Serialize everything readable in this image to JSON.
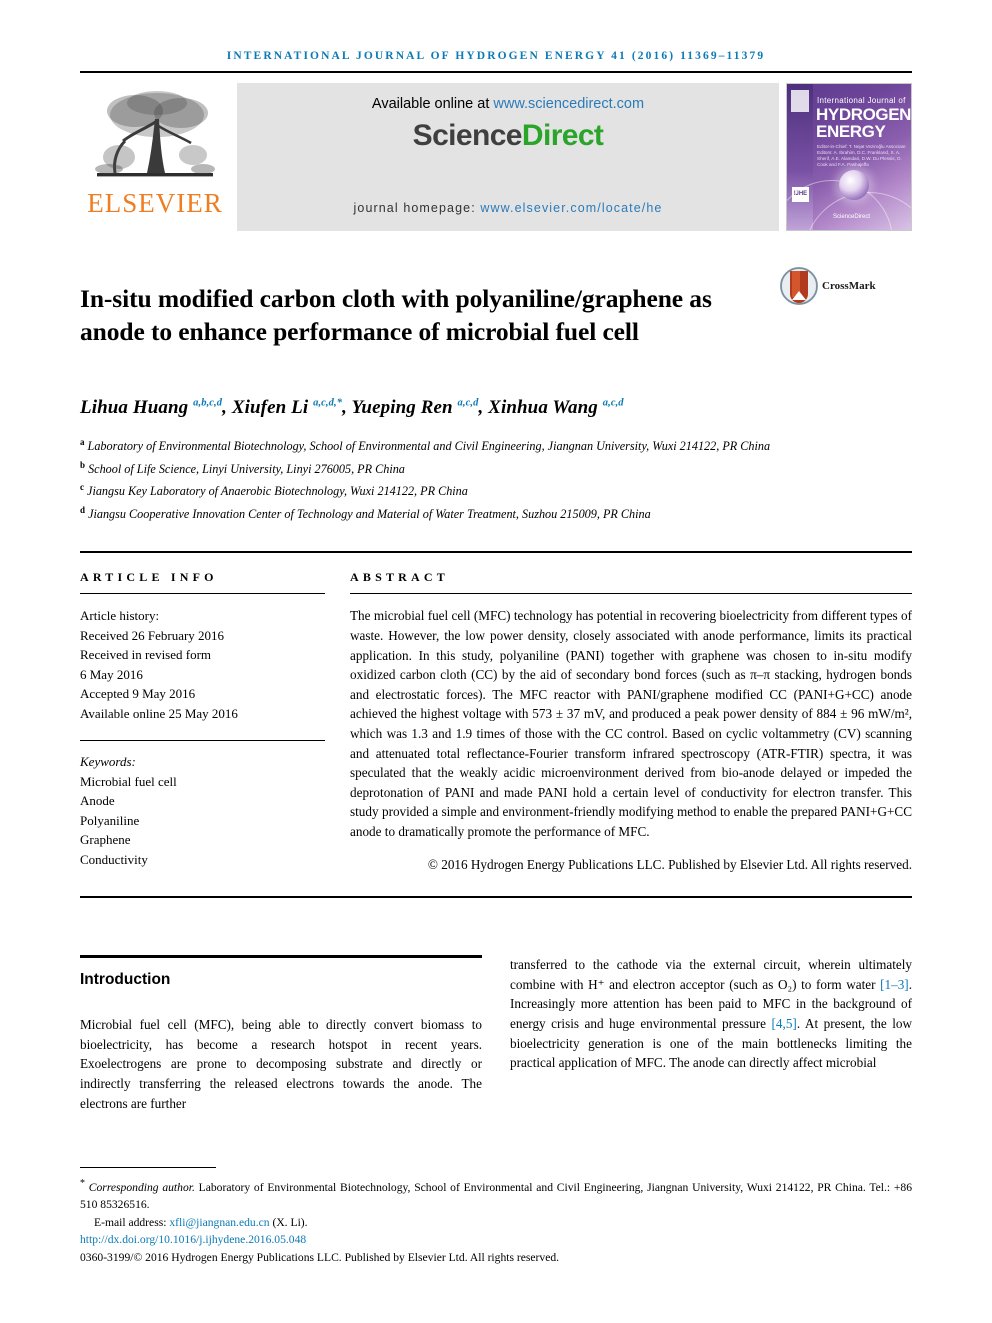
{
  "running_head": "International Journal of Hydrogen Energy 41 (2016) 11369–11379",
  "masthead": {
    "elsevier_wordmark": "ELSEVIER",
    "available_online_label": "Available online at",
    "available_online_url": "www.sciencedirect.com",
    "sciencedirect_part1": "Science",
    "sciencedirect_part2": "Direct",
    "journal_homepage_label": "journal homepage:",
    "journal_homepage_url": "www.elsevier.com/locate/he",
    "cover": {
      "small_title": "International Journal of",
      "big_title_line1": "HYDROGEN",
      "big_title_line2": "ENERGY",
      "editors": "Editor-in-Chief: T. Nejat Veziroğlu   Associate Editors: A. Ibrahim, D.C. Frankland, S. A. Sherif, A.E. Alamdari, D.W. Du Plessis, D. Cook and F.A. Pashajeffa",
      "ijhe_badge": "IJHE",
      "sciencedirect_mark": "ScienceDirect"
    }
  },
  "crossmark": {
    "label": "CrossMark"
  },
  "article": {
    "title": "In-situ modified carbon cloth with polyaniline/graphene as anode to enhance performance of microbial fuel cell",
    "authors": [
      {
        "name": "Lihua Huang",
        "sup": "a,b,c,d",
        "sep": ", "
      },
      {
        "name": "Xiufen Li",
        "sup": "a,c,d,*",
        "sep": ", "
      },
      {
        "name": "Yueping Ren",
        "sup": "a,c,d",
        "sep": ", "
      },
      {
        "name": "Xinhua Wang",
        "sup": "a,c,d",
        "sep": ""
      }
    ],
    "affiliations": [
      {
        "mark": "a",
        "text": "Laboratory of Environmental Biotechnology, School of Environmental and Civil Engineering, Jiangnan University, Wuxi 214122, PR China"
      },
      {
        "mark": "b",
        "text": "School of Life Science, Linyi University, Linyi 276005, PR China"
      },
      {
        "mark": "c",
        "text": "Jiangsu Key Laboratory of Anaerobic Biotechnology, Wuxi 214122, PR China"
      },
      {
        "mark": "d",
        "text": "Jiangsu Cooperative Innovation Center of Technology and Material of Water Treatment, Suzhou 215009, PR China"
      }
    ]
  },
  "article_info": {
    "heading": "Article info",
    "history_title": "Article history:",
    "history": [
      "Received 26 February 2016",
      "Received in revised form",
      "6 May 2016",
      "Accepted 9 May 2016",
      "Available online 25 May 2016"
    ],
    "keywords_title": "Keywords:",
    "keywords": [
      "Microbial fuel cell",
      "Anode",
      "Polyaniline",
      "Graphene",
      "Conductivity"
    ]
  },
  "abstract": {
    "heading": "Abstract",
    "text": "The microbial fuel cell (MFC) technology has potential in recovering bioelectricity from different types of waste. However, the low power density, closely associated with anode performance, limits its practical application. In this study, polyaniline (PANI) together with graphene was chosen to in-situ modify oxidized carbon cloth (CC) by the aid of secondary bond forces (such as π–π stacking, hydrogen bonds and electrostatic forces). The MFC reactor with PANI/graphene modified CC (PANI+G+CC) anode achieved the highest voltage with 573 ± 37 mV, and produced a peak power density of 884 ± 96 mW/m², which was 1.3 and 1.9 times of those with the CC control. Based on cyclic voltammetry (CV) scanning and attenuated total reflectance-Fourier transform infrared spectroscopy (ATR-FTIR) spectra, it was speculated that the weakly acidic microenvironment derived from bio-anode delayed or impeded the deprotonation of PANI and made PANI hold a certain level of conductivity for electron transfer. This study provided a simple and environment-friendly modifying method to enable the prepared PANI+G+CC anode to dramatically promote the performance of MFC.",
    "copyright": "© 2016 Hydrogen Energy Publications LLC. Published by Elsevier Ltd. All rights reserved."
  },
  "introduction": {
    "heading": "Introduction",
    "left_paragraph": "Microbial fuel cell (MFC), being able to directly convert biomass to bioelectricity, has become a research hotspot in recent years. Exoelectrogens are prone to decomposing substrate and directly or indirectly transferring the released electrons towards the anode. The electrons are further",
    "right_paragraph_part1": "transferred to the cathode via the external circuit, wherein ultimately combine with H⁺ and electron acceptor (such as O₂) to form water ",
    "right_citation1": "[1–3]",
    "right_paragraph_part2": ". Increasingly more attention has been paid to MFC in the background of energy crisis and huge environmental pressure ",
    "right_citation2": "[4,5]",
    "right_paragraph_part3": ". At present, the low bioelectricity generation is one of the main bottlenecks limiting the practical application of MFC. The anode can directly affect microbial"
  },
  "footer": {
    "corresponding_label": "Corresponding author.",
    "corresponding_text": " Laboratory of Environmental Biotechnology, School of Environmental and Civil Engineering, Jiangnan University, Wuxi 214122, PR China. Tel.: +86 510 85326516.",
    "email_label": "E-mail address:",
    "email": "xfli@jiangnan.edu.cn",
    "email_owner": "(X. Li).",
    "doi": "http://dx.doi.org/10.1016/j.ijhydene.2016.05.048",
    "issn_line": "0360-3199/© 2016 Hydrogen Energy Publications LLC. Published by Elsevier Ltd. All rights reserved."
  },
  "colors": {
    "journal_blue": "#0b7ab5",
    "link_blue": "#2b7bb9",
    "elsevier_orange": "#ef7d22",
    "sciencedirect_green": "#2aa52a",
    "panel_gray": "#e3e3e3"
  }
}
